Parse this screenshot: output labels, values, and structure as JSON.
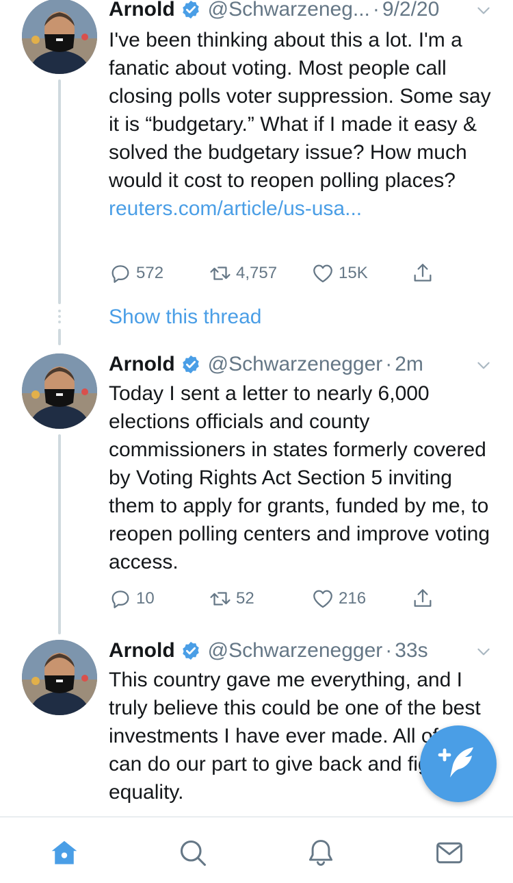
{
  "tweets": [
    {
      "name": "Arnold",
      "handle": "@Schwarzeneg...",
      "time": "9/2/20",
      "text": "I've been thinking about this a lot. I'm a fanatic about voting. Most people call closing polls voter suppression. Some say it is “budgetary.” What if I made it easy & solved the budgetary issue? How much would it cost to reopen polling places?",
      "link": "reuters.com/article/us-usa...",
      "replies": "572",
      "retweets": "4,757",
      "likes": "15K",
      "show_thread": "Show this thread"
    },
    {
      "name": "Arnold",
      "handle": "@Schwarzenegger",
      "time": "2m",
      "text": "Today I sent a letter to nearly 6,000 elections officials and county commissioners in states formerly covered by Voting Rights Act Section 5 inviting them to apply for grants, funded by me, to reopen polling centers and improve voting access.",
      "replies": "10",
      "retweets": "52",
      "likes": "216"
    },
    {
      "name": "Arnold",
      "handle": "@Schwarzenegger",
      "time": "33s",
      "text": "This country gave me everything, and I truly believe this could be one of the best investments I have ever made. All of us can do our part to give back and fight for equality."
    }
  ],
  "colors": {
    "accent": "#4a9ee6",
    "secondary_text": "#657786",
    "primary_text": "#14171a",
    "thread_line": "#cfd9de"
  },
  "icons": {
    "verified": "verified-badge-icon",
    "menu": "chevron-down-icon",
    "reply": "reply-icon",
    "retweet": "retweet-icon",
    "like": "heart-icon",
    "share": "share-icon",
    "compose": "compose-tweet-icon"
  },
  "bottom_nav": [
    {
      "icon": "home-icon",
      "active": true
    },
    {
      "icon": "search-icon",
      "active": false
    },
    {
      "icon": "notifications-icon",
      "active": false
    },
    {
      "icon": "messages-icon",
      "active": false
    }
  ]
}
